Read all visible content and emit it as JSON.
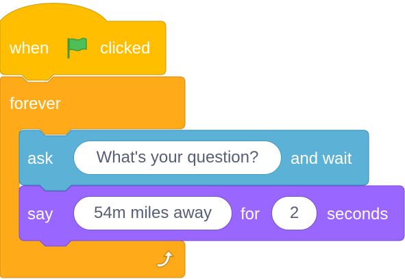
{
  "colors": {
    "events": "#ffbf00",
    "events_border": "#cc9900",
    "control": "#ffab19",
    "control_border": "#cf8b17",
    "sensing": "#5cb1d6",
    "sensing_border": "#2e8eb8",
    "looks": "#9966ff",
    "looks_border": "#774dcb",
    "flag_green": "#4cbf56",
    "input_text": "#575e75"
  },
  "hat_block": {
    "when_label": "when",
    "flag_icon": "green-flag-icon",
    "clicked_label": "clicked"
  },
  "forever_block": {
    "label": "forever",
    "loop_icon": "loop-arrow-icon"
  },
  "ask_block": {
    "label": "ask",
    "question": "What's your question?",
    "suffix": "and wait"
  },
  "say_block": {
    "label": "say",
    "message": "54m miles away",
    "for_label": "for",
    "seconds_value": "2",
    "seconds_label": "seconds"
  }
}
